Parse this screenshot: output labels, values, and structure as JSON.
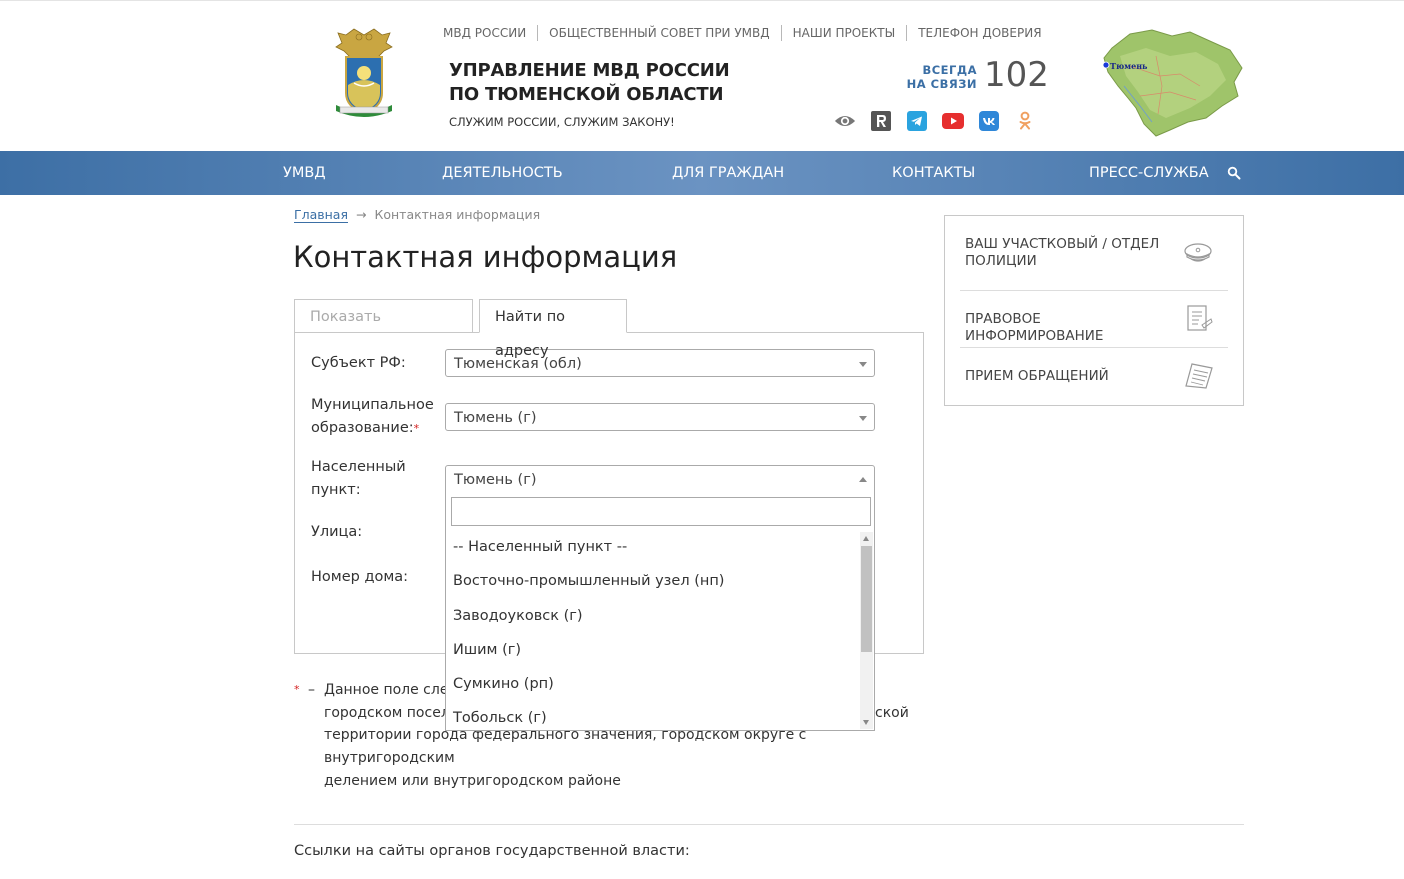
{
  "header": {
    "top_links": [
      "МВД РОССИИ",
      "ОБЩЕСТВЕННЫЙ СОВЕТ ПРИ УМВД",
      "НАШИ ПРОЕКТЫ",
      "ТЕЛЕФОН ДОВЕРИЯ"
    ],
    "title_line1": "УПРАВЛЕНИЕ МВД РОССИИ",
    "title_line2": "ПО ТЮМЕНСКОЙ ОБЛАСТИ",
    "slogan": "СЛУЖИМ РОССИИ, СЛУЖИМ ЗАКОНУ!",
    "always_line1": "ВСЕГДА",
    "always_line2": "НА СВЯЗИ",
    "phone": "102",
    "map_label": "Тюмень",
    "socials": [
      "eye-icon",
      "rutube-icon",
      "telegram-icon",
      "youtube-icon",
      "vk-icon",
      "odnoklassniki-icon"
    ],
    "colors": {
      "accent": "#3b6fa5",
      "nav_start": "#3d6fa5",
      "nav_mid": "#6b93c2"
    }
  },
  "nav": {
    "items": [
      "УМВД",
      "ДЕЯТЕЛЬНОСТЬ",
      "ДЛЯ ГРАЖДАН",
      "КОНТАКТЫ",
      "ПРЕСС-СЛУЖБА"
    ],
    "search_icon": "search-icon"
  },
  "breadcrumb": {
    "home": "Главная",
    "arrow": "→",
    "current": "Контактная информация"
  },
  "page_title": "Контактная информация",
  "tabs": [
    {
      "label": "Показать ближайшие",
      "active": false
    },
    {
      "label": "Найти по адресу",
      "active": true
    }
  ],
  "form": {
    "subject_label": "Субъект РФ:",
    "subject_value": "Тюменская (обл)",
    "municipal_label_1": "Муниципальное",
    "municipal_label_2": "образование:",
    "required_mark": "*",
    "municipal_value": "Тюмень (г)",
    "locality_label_1": "Населенный",
    "locality_label_2": "пункт:",
    "locality_value": "Тюмень (г)",
    "street_label": "Улица:",
    "house_label": "Номер дома:"
  },
  "dropdown": {
    "search_value": "",
    "options": [
      "-- Населенный пункт --",
      "Восточно-промышленный узел (нп)",
      "Заводоуковск (г)",
      "Ишим (г)",
      "Сумкино (рп)",
      "Тобольск (г)"
    ]
  },
  "note": {
    "star": "*",
    "dash": "–",
    "line1": "Данное поле след",
    "line2_start": "городском посел",
    "line2_end": "ской",
    "line3": "территории города федерального значения, городском округе с внутригородским",
    "line4": "делением или внутригородском районе"
  },
  "links_title": "Ссылки на сайты органов государственной власти:",
  "sidebar": {
    "items": [
      {
        "label_1": "ВАШ УЧАСТКОВЫЙ / ОТДЕЛ",
        "label_2": "ПОЛИЦИИ",
        "icon": "police-cap-icon"
      },
      {
        "label": "ПРАВОВОЕ ИНФОРМИРОВАНИЕ",
        "icon": "legal-document-icon"
      },
      {
        "label": "ПРИЕМ ОБРАЩЕНИЙ",
        "icon": "appeal-paper-icon"
      }
    ]
  }
}
